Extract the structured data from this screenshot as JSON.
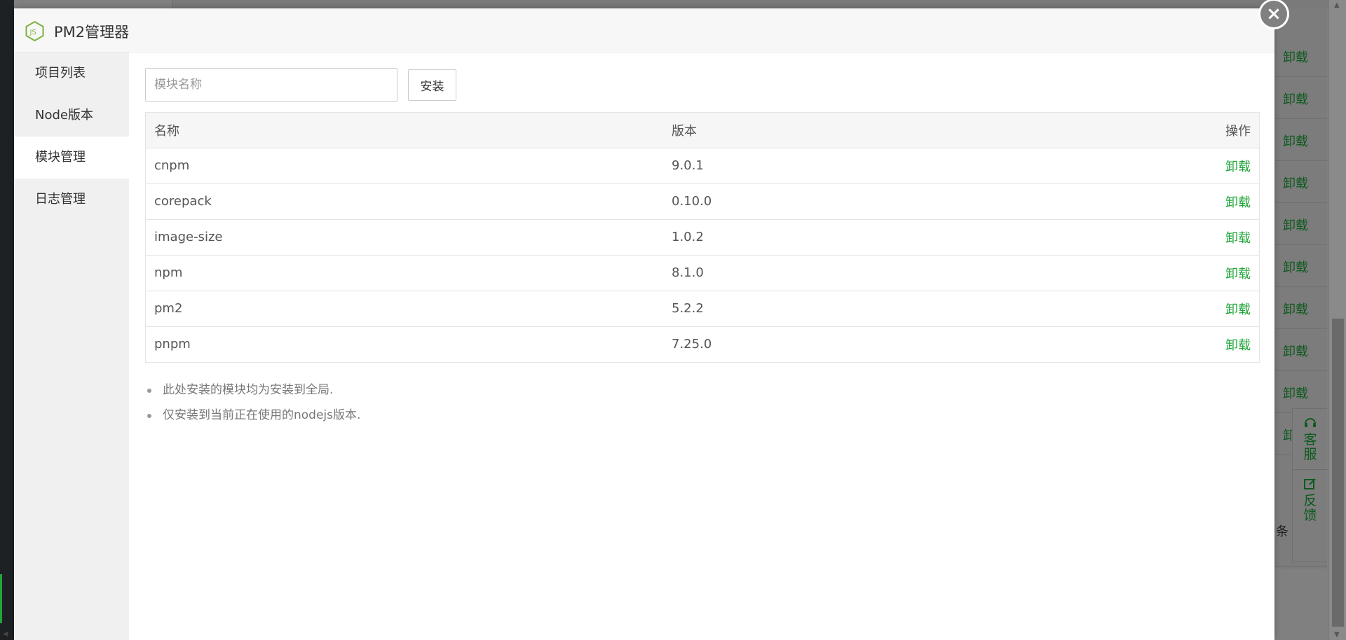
{
  "modal": {
    "title": "PM2管理器",
    "logo_icon": "nodejs-logo-icon"
  },
  "sidebar": {
    "items": [
      {
        "label": "项目列表",
        "active": false
      },
      {
        "label": "Node版本",
        "active": false
      },
      {
        "label": "模块管理",
        "active": true
      },
      {
        "label": "日志管理",
        "active": false
      }
    ]
  },
  "install": {
    "placeholder": "模块名称",
    "value": "",
    "button_label": "安装"
  },
  "table": {
    "headers": {
      "name": "名称",
      "version": "版本",
      "action": "操作"
    },
    "rows": [
      {
        "name": "cnpm",
        "version": "9.0.1",
        "action": "卸载"
      },
      {
        "name": "corepack",
        "version": "0.10.0",
        "action": "卸载"
      },
      {
        "name": "image-size",
        "version": "1.0.2",
        "action": "卸载"
      },
      {
        "name": "npm",
        "version": "8.1.0",
        "action": "卸载"
      },
      {
        "name": "pm2",
        "version": "5.2.2",
        "action": "卸载"
      },
      {
        "name": "pnpm",
        "version": "7.25.0",
        "action": "卸载"
      }
    ]
  },
  "notes": [
    "此处安装的模块均为安装到全局.",
    "仅安装到当前正在使用的nodejs版本."
  ],
  "background": {
    "row_action": "卸载",
    "count_suffix": "条",
    "float_panel": {
      "service": "客服",
      "feedback": "反馈"
    }
  },
  "colors": {
    "accent": "#20a53a",
    "overlay": "#808080"
  }
}
